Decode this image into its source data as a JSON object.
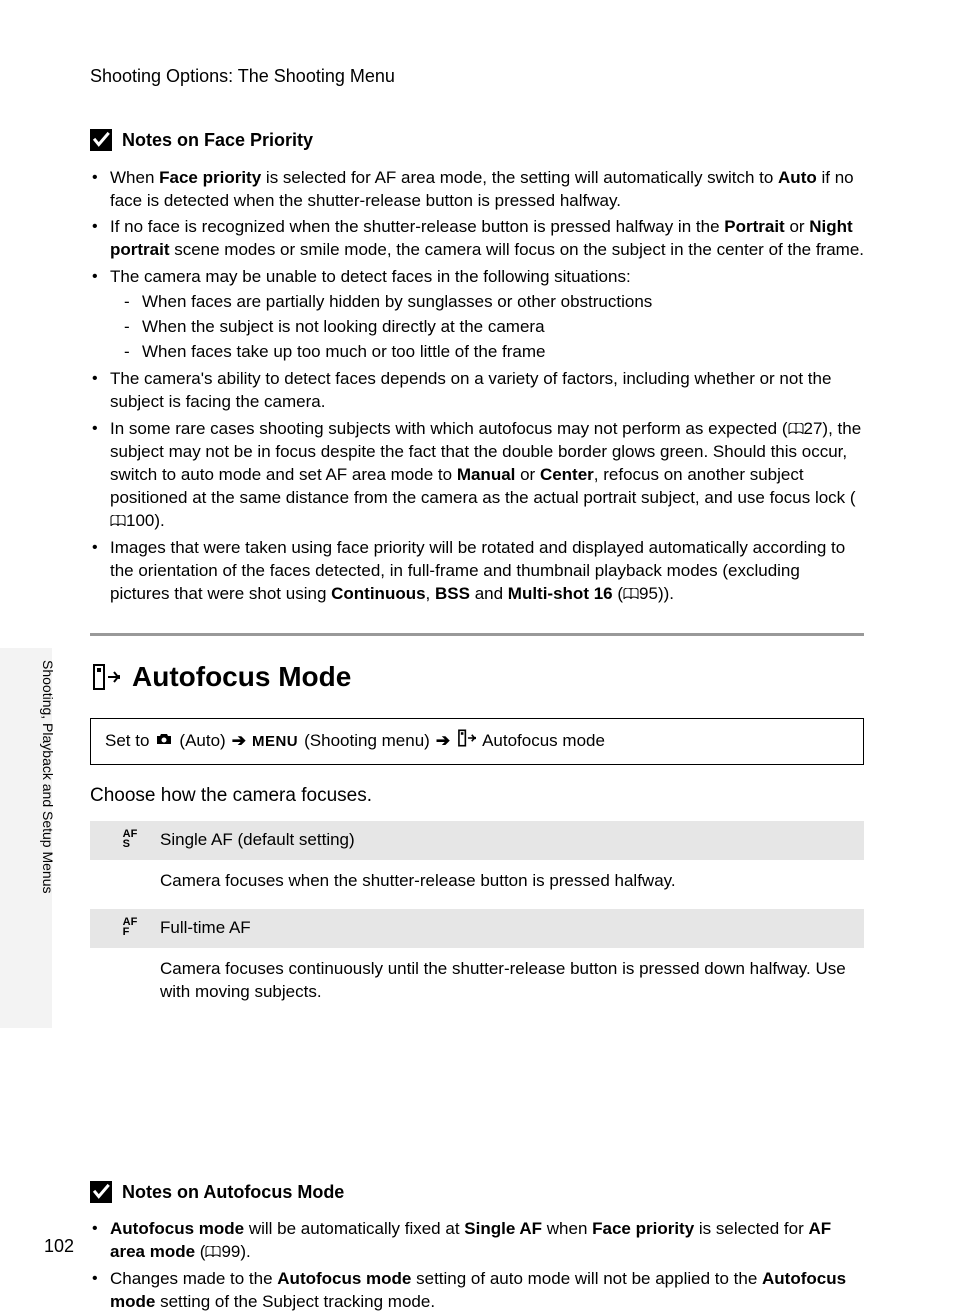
{
  "header": "Shooting Options: The Shooting Menu",
  "sideTab": "Shooting, Playback and Setup Menus",
  "pageNumber": "102",
  "note1": {
    "title": "Notes on Face Priority",
    "b1_a": "When ",
    "b1_bold1": "Face priority",
    "b1_b": " is selected for AF area mode, the setting will automatically switch to ",
    "b1_bold2": "Auto",
    "b1_c": " if no face is detected when the shutter-release button is pressed halfway.",
    "b2_a": "If no face is recognized when the shutter-release button is pressed halfway in the ",
    "b2_bold1": "Portrait",
    "b2_b": " or ",
    "b2_bold2": "Night portrait",
    "b2_c": " scene modes or smile mode, the camera will focus on the subject in the center of the frame.",
    "b3": "The camera may be unable to detect faces in the following situations:",
    "b3_d1": "When faces are partially hidden by sunglasses or other obstructions",
    "b3_d2": "When the subject is not looking directly at the camera",
    "b3_d3": "When faces take up too much or too little of the frame",
    "b4": "The camera's ability to detect faces depends on a variety of factors, including whether or not the subject is facing the camera.",
    "b5_a": "In some rare cases shooting subjects with which autofocus may not perform as expected (",
    "b5_ref1": "27",
    "b5_b": "), the subject may not be in focus despite the fact that the double border glows green. Should this occur, switch to auto mode and set AF area mode to ",
    "b5_bold1": "Manual",
    "b5_c": " or ",
    "b5_bold2": "Center",
    "b5_d": ", refocus on another subject positioned at the same distance from the camera as the actual portrait subject, and use focus lock (",
    "b5_ref2": "100",
    "b5_e": ").",
    "b6_a": "Images that were taken using face priority will be rotated and displayed automatically according to the orientation of the faces detected, in full-frame and thumbnail playback modes (excluding pictures that were shot using ",
    "b6_bold1": "Continuous",
    "b6_b": ", ",
    "b6_bold2": "BSS",
    "b6_c": " and ",
    "b6_bold3": "Multi-shot 16",
    "b6_d": " (",
    "b6_ref": "95",
    "b6_e": "))."
  },
  "section": {
    "title": "Autofocus Mode",
    "path_setTo": "Set to ",
    "path_auto": " (Auto) ",
    "path_menu": "MENU",
    "path_shootingMenu": " (Shooting menu) ",
    "path_afMode": " Autofocus mode",
    "intro": "Choose how the camera focuses.",
    "opt1_icon": "AF\nS",
    "opt1_title": "Single AF (default setting)",
    "opt1_desc": "Camera focuses when the shutter-release button is pressed halfway.",
    "opt2_icon": "AF\nF",
    "opt2_title": "Full-time AF",
    "opt2_desc": "Camera focuses continuously until the shutter-release button is pressed down halfway. Use with moving subjects."
  },
  "note2": {
    "title": "Notes on Autofocus Mode",
    "b1_bold1": "Autofocus mode",
    "b1_a": " will be automatically fixed at ",
    "b1_bold2": "Single AF",
    "b1_b": " when ",
    "b1_bold3": "Face priority",
    "b1_c": " is selected for ",
    "b1_bold4": "AF area mode",
    "b1_d": " (",
    "b1_ref": "99",
    "b1_e": ").",
    "b2_a": "Changes made to the ",
    "b2_bold1": "Autofocus mode",
    "b2_b": " setting of auto mode will not be applied to the ",
    "b2_bold2": "Autofocus mode",
    "b2_c": " setting of the Subject tracking mode."
  }
}
